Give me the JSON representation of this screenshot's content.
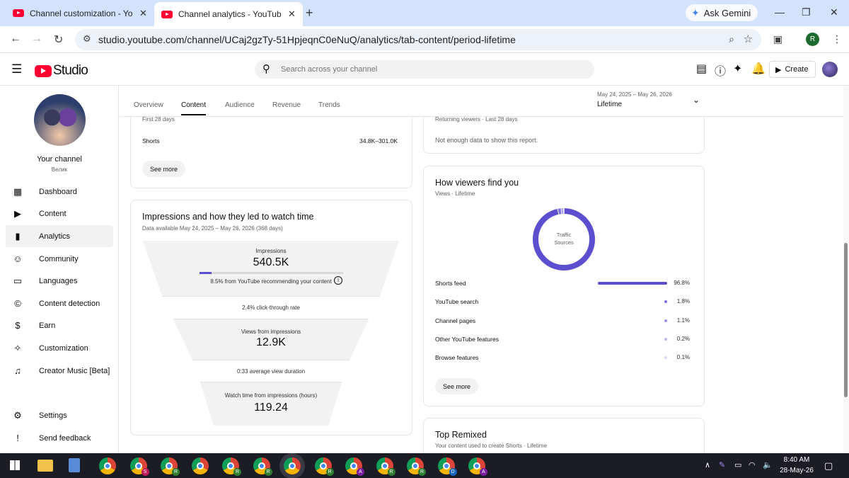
{
  "browser": {
    "tabs": [
      {
        "title": "Channel customization - YouTube",
        "active": false
      },
      {
        "title": "Channel analytics - YouTube Studio",
        "active": true
      }
    ],
    "new_tab": "+",
    "gemini_label": "Ask Gemini",
    "url": "studio.youtube.com/channel/UCaj2gzTy-51HpjeqnC0eNuQ/analytics/tab-content/period-lifetime",
    "profile_initial": "R"
  },
  "header": {
    "logo_text": "Studio",
    "search_placeholder": "Search across your channel",
    "create_label": "Create"
  },
  "sidebar": {
    "channel_name": "Your channel",
    "channel_handle": "Велик",
    "items": [
      {
        "label": "Dashboard",
        "icon": "dashboard-icon",
        "active": false
      },
      {
        "label": "Content",
        "icon": "content-icon",
        "active": false
      },
      {
        "label": "Analytics",
        "icon": "analytics-icon",
        "active": true
      },
      {
        "label": "Community",
        "icon": "community-icon",
        "active": false
      },
      {
        "label": "Languages",
        "icon": "languages-icon",
        "active": false
      },
      {
        "label": "Content detection",
        "icon": "copyright-icon",
        "active": false
      },
      {
        "label": "Earn",
        "icon": "dollar-icon",
        "active": false
      },
      {
        "label": "Customization",
        "icon": "magic-wand-icon",
        "active": false
      },
      {
        "label": "Creator Music [Beta]",
        "icon": "music-icon",
        "active": false
      }
    ],
    "bottom_items": [
      {
        "label": "Settings",
        "icon": "gear-icon"
      },
      {
        "label": "Send feedback",
        "icon": "feedback-icon"
      }
    ]
  },
  "tabs": [
    "Overview",
    "Content",
    "Audience",
    "Revenue",
    "Trends"
  ],
  "active_tab": "Content",
  "date_range": {
    "range": "May 24, 2025 – May 26, 2026",
    "label": "Lifetime"
  },
  "top_left_card": {
    "cut_label": "First 28 days",
    "row_label": "Shorts",
    "row_value": "34.8K–301.0K",
    "see_more": "See more"
  },
  "top_right_card": {
    "cut_label": "Returning viewers · Last 28 days",
    "message": "Not enough data to show this report."
  },
  "funnel_card": {
    "title": "Impressions and how they led to watch time",
    "subtitle": "Data available May 24, 2025 – May 26, 2026 (368 days)",
    "impressions_label": "Impressions",
    "impressions_value": "540.5K",
    "recommend_text": "8.5% from YouTube recommending your content",
    "recommend_fraction": 0.085,
    "ctr_text": "2.4% click-through rate",
    "views_label": "Views from impressions",
    "views_value": "12.9K",
    "avd_text": "0:33 average view duration",
    "watch_label": "Watch time from impressions (hours)",
    "watch_value": "119.24"
  },
  "traffic_card": {
    "title": "How viewers find you",
    "subtitle": "Views · Lifetime",
    "donut_label_1": "Traffic",
    "donut_label_2": "Sources",
    "sources": [
      {
        "name": "Shorts feed",
        "pct": "96.8%",
        "value": 96.8,
        "color": "#5b4fcf"
      },
      {
        "name": "YouTube search",
        "pct": "1.8%",
        "value": 1.8,
        "color": "#7b6fe0"
      },
      {
        "name": "Channel pages",
        "pct": "1.1%",
        "value": 1.1,
        "color": "#9a90ea"
      },
      {
        "name": "Other YouTube features",
        "pct": "0.2%",
        "value": 0.2,
        "color": "#bcb5f2"
      },
      {
        "name": "Browse features",
        "pct": "0.1%",
        "value": 0.1,
        "color": "#dcd8f8"
      }
    ],
    "see_more": "See more"
  },
  "remixed_card": {
    "title": "Top Remixed",
    "subtitle": "Your content used to create Shorts · Lifetime"
  },
  "taskbar": {
    "time": "8:40 AM",
    "date": "28-May-26",
    "apps": [
      {
        "name": "file-explorer-icon"
      },
      {
        "name": "calculator-icon"
      },
      {
        "name": "chrome-icon",
        "badge": ""
      },
      {
        "name": "chrome-icon",
        "badge": "S"
      },
      {
        "name": "chrome-icon",
        "badge": "R"
      },
      {
        "name": "chrome-icon",
        "badge": ""
      },
      {
        "name": "chrome-icon",
        "badge": "R"
      },
      {
        "name": "chrome-icon",
        "badge": "R"
      },
      {
        "name": "chrome-icon",
        "badge": ""
      },
      {
        "name": "chrome-icon",
        "badge": "R"
      },
      {
        "name": "chrome-icon",
        "badge": "A"
      },
      {
        "name": "chrome-icon",
        "badge": "R"
      },
      {
        "name": "chrome-icon",
        "badge": "R"
      },
      {
        "name": "chrome-icon",
        "badge": "D"
      },
      {
        "name": "chrome-icon",
        "badge": "A"
      }
    ]
  },
  "colors": {
    "accent": "#5b4fcf",
    "youtube_red": "#ff0033",
    "tabbar": "#d3e3fd"
  }
}
